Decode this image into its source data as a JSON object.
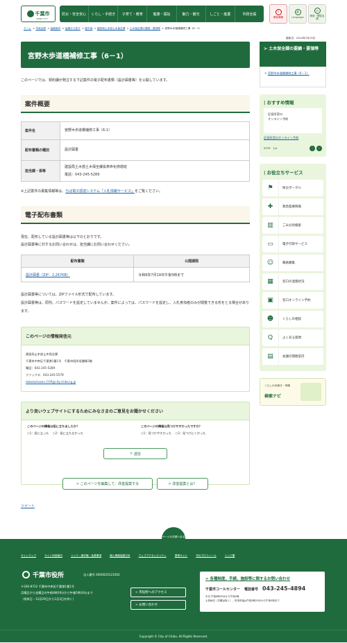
{
  "header": {
    "logo_text": "千葉市",
    "logo_sub": "CHIBA CITY",
    "nav": [
      "防災・安全安心",
      "くらし・手続き",
      "子育て・教育",
      "健康・福祉",
      "魅力・観光",
      "しごと・産業",
      "市政全般"
    ],
    "icons": [
      {
        "label": "緊急情報",
        "icon": "warning-icon"
      },
      {
        "label": "Language",
        "icon": "language-icon"
      },
      {
        "label": "検索・閲覧支援",
        "icon": "glasses-icon"
      }
    ]
  },
  "breadcrumb": [
    "ホーム",
    "市政全般",
    "組織案内",
    "組織から探す",
    "都市局",
    "建設局土木部土木保全課",
    "土木保全課の要綱・要領等",
    "宮野木歩道橋補修工事（6－1）"
  ],
  "updated": "更新日：2024年7月19日",
  "main": {
    "title": "宮野木歩道橋補修工事（6－1）",
    "intro": "このページでは、契約課が発注する下記案件の電子配布書類（設計図書等）を公開しています。",
    "overview_heading": "案件概要",
    "info_rows": [
      {
        "label": "案件名",
        "value": "宮野木歩道橋補修工事（6-1）"
      },
      {
        "label": "配布書類の種別",
        "value": "設計図書"
      },
      {
        "label": "担当課・係等",
        "value": "建設局土木部土木保全課長寿命化修繕班",
        "value2": "電話：043-245-5289"
      }
    ],
    "note_prefix": "※上記案件の募集情報等は、",
    "note_link": "ちば電子調達システム「入札情報サービス」",
    "note_suffix": "をご覧ください。",
    "dl_heading": "電子配布書類",
    "dl_intro1": "現在、配布している設計図書等は以下のとおりです。",
    "dl_intro2": "設計図書等に対するお問い合わせは、担当課にお問い合わせください。",
    "dl_table": {
      "headers": [
        "配布書類",
        "公開期限"
      ],
      "rows": [
        {
          "doc": "設計図書（ZIP：2,267KB）",
          "deadline": "令和6年7月19日午後5時まで"
        }
      ]
    },
    "dl_note1": "設計図書等については、ZIPファイル形式で配布しています。",
    "dl_note2": "設計図書等は、原則、パスワードを設定していませんが、案件によっては、パスワードを設定し、入札参加者のみが閲覧できる形をとる場合があります。",
    "contact": {
      "heading": "このページの情報発信元",
      "lines": [
        "建設局土木部土木保全課",
        "千葉市中央区千葉港1番1号　千葉市役所低層棟3階",
        "電話：043-245-5289",
        "ファックス：043-245-5579"
      ],
      "email": "dobokuhozen.COP@city.chiba.lg.jp"
    },
    "survey": {
      "heading": "より良いウェブサイトにするためにみなさまのご意見をお聞かせください",
      "q1": "このページの情報は役に立ちましたか？",
      "q1_opts": [
        "1：役に立った",
        "2：役に立たなかった"
      ],
      "q2": "このページの情報は見つけやすかったですか？",
      "q2_opts": [
        "1：見つけやすかった",
        "2：見つけにくかった"
      ],
      "send": "送信",
      "edit": "このページを編集して、改善提案する",
      "proposal": "改善提案とは？"
    },
    "tweet": "ツイート"
  },
  "sidebar": {
    "sub_heading": "土木保全課の要綱・要領等",
    "sub_link": "宮野木歩道橋補修工事（6－1）",
    "pick_heading": "おすすめ情報",
    "pick_img1": "区役所窓口",
    "pick_img2": "オンライン予約",
    "pick_link": "区役所窓口オンライン予約",
    "pick_ctl": "STOP　1/4",
    "useful_heading": "お役立ちサービス",
    "useful": [
      {
        "label": "防災ポータル",
        "icon": "disaster-icon"
      },
      {
        "label": "救急医療情報",
        "icon": "ambulance-icon"
      },
      {
        "label": "ごみ分別検索",
        "icon": "trash-icon"
      },
      {
        "label": "電子行政サービス",
        "icon": "computer-icon"
      },
      {
        "label": "職員募集",
        "icon": "people-icon"
      },
      {
        "label": "窓口の混雑状況",
        "icon": "counter-icon"
      },
      {
        "label": "窓口オンライン予約",
        "icon": "reservation-icon"
      },
      {
        "label": "くらしの相談",
        "icon": "consult-icon"
      },
      {
        "label": "よくある質問",
        "icon": "faq-icon"
      },
      {
        "label": "会議の開催案内",
        "icon": "calendar-icon"
      }
    ],
    "navi1": "くらしの手続き・申請",
    "navi2": "検索ナビ"
  },
  "footer": {
    "pagetop": "ページの先頭へ戻る",
    "links": [
      "サイトマップ",
      "サイト利用案内",
      "リンク・著作権・免責事項",
      "個人情報保護方針",
      "ウェブアクセシビリティ",
      "携帯サイト",
      "市のプロフィール",
      "リンク集"
    ],
    "name": "千葉市役所",
    "corp": "法人番号 6000020121002",
    "addr": [
      "〒260-8722 千葉市中央区千葉港1番1号",
      "月曜日から金曜日の午前8時30分から午後5時30分まで",
      "（祝休日・12月29日から1月3日を除く）"
    ],
    "btn_access": "市役所へのアクセス",
    "btn_contact": "お問い合わせ",
    "call_title": "各種制度、手続、施設等に関するお問い合わせ",
    "call_center": "千葉市コールセンター",
    "call_label": "電話番号",
    "call_tel": "043-245-4894",
    "call_hours1": "平日 午前8時30分から午後9時",
    "call_hours2": "土祝休日（日曜は除く）、年末年始は午前8時30分から午後5時まで",
    "copyright": "Copyright © City of Chiba. All Rights Reserved."
  },
  "colors": {
    "brand": "#1f6b3d",
    "light": "#eaf5dd",
    "link": "#1a5fa8"
  }
}
